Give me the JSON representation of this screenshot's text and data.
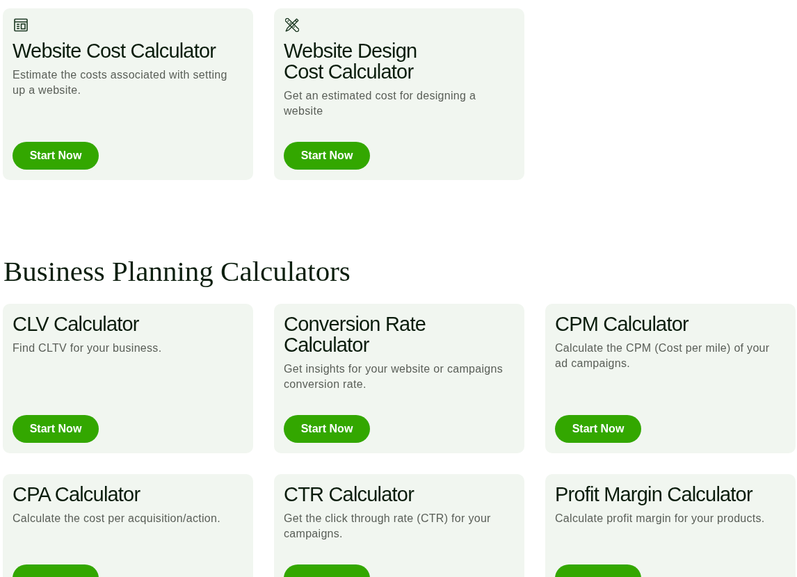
{
  "groups": [
    {
      "cards": [
        {
          "title": "Website Cost Calculator",
          "description": "Estimate the costs associated with setting up a website.",
          "button": "Start Now"
        },
        {
          "title": "Website Design\nCost Calculator",
          "description": "Get an estimated cost for designing a website",
          "button": "Start Now"
        }
      ]
    },
    {
      "heading": "Business Planning Calculators",
      "cards": [
        {
          "title": "CLV Calculator",
          "description": "Find CLTV for your business.",
          "button": "Start Now"
        },
        {
          "title": "Conversion Rate\nCalculator",
          "description": "Get insights for your website or campaigns conversion rate.",
          "button": "Start Now"
        },
        {
          "title": "CPM Calculator",
          "description": "Calculate the CPM (Cost per mile) of your ad campaigns.",
          "button": "Start Now"
        },
        {
          "title": "CPA Calculator",
          "description": "Calculate the cost per acquisition/action."
        },
        {
          "title": "CTR Calculator",
          "description": "Get the click through rate (CTR) for your campaigns."
        },
        {
          "title": "Profit Margin Calculator",
          "description": "Calculate profit margin for your products."
        }
      ]
    }
  ]
}
